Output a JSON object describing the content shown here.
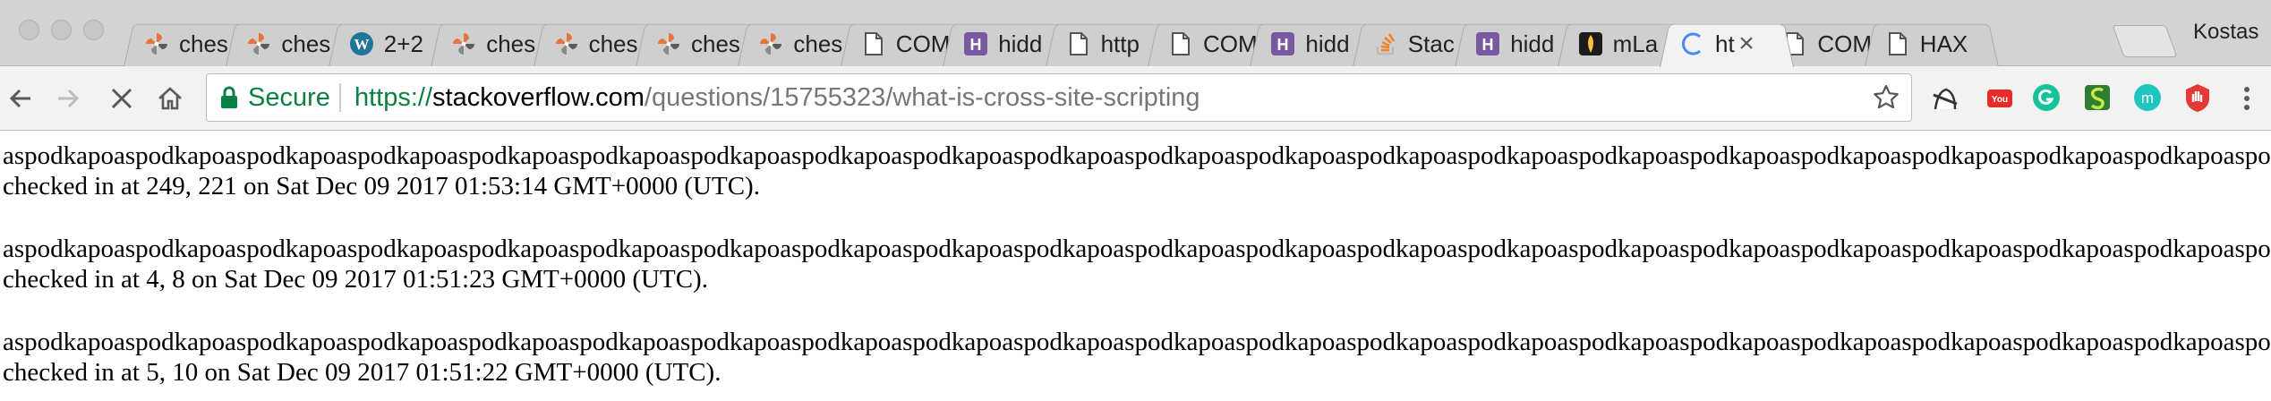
{
  "window": {
    "profile_name": "Kostas"
  },
  "tabs": [
    {
      "title": "ches",
      "icon": "pinwheel-icon",
      "active": false
    },
    {
      "title": "ches",
      "icon": "pinwheel-icon",
      "active": false
    },
    {
      "title": "2+2",
      "icon": "wordpress-icon",
      "active": false
    },
    {
      "title": "ches",
      "icon": "pinwheel-icon",
      "active": false
    },
    {
      "title": "ches",
      "icon": "pinwheel-icon",
      "active": false
    },
    {
      "title": "ches",
      "icon": "pinwheel-icon",
      "active": false
    },
    {
      "title": "ches",
      "icon": "pinwheel-icon",
      "active": false
    },
    {
      "title": "COM",
      "icon": "page-icon",
      "active": false
    },
    {
      "title": "hidd",
      "icon": "heroku-icon",
      "active": false
    },
    {
      "title": "http",
      "icon": "page-icon",
      "active": false
    },
    {
      "title": "COM",
      "icon": "page-icon",
      "active": false
    },
    {
      "title": "hidd",
      "icon": "heroku-icon",
      "active": false
    },
    {
      "title": "Stac",
      "icon": "stackoverflow-icon",
      "active": false
    },
    {
      "title": "hidd",
      "icon": "heroku-icon",
      "active": false
    },
    {
      "title": "mLa",
      "icon": "mlab-icon",
      "active": false
    },
    {
      "title": "ht",
      "icon": "loading-spinner-icon",
      "active": true
    },
    {
      "title": "COM",
      "icon": "page-icon",
      "active": false
    },
    {
      "title": "HAX",
      "icon": "page-icon",
      "active": false
    }
  ],
  "toolbar": {
    "secure_label": "Secure",
    "url_scheme": "https://",
    "url_host": "stackoverflow.com",
    "url_path": "/questions/15755323/what-is-cross-site-scripting"
  },
  "extensions": [
    {
      "icon": "ghost-extension-icon"
    },
    {
      "icon": "youtube-extension-icon"
    },
    {
      "icon": "grammarly-extension-icon"
    },
    {
      "icon": "green-s-extension-icon"
    },
    {
      "icon": "m-extension-icon"
    },
    {
      "icon": "hand-stop-extension-icon"
    }
  ],
  "entries": [
    {
      "spam": "aspodkapoaspodkapoaspodkapoaspodkapoaspodkapoaspodkapoaspodkapoaspodkapoaspodkapoaspodkapoaspodkapoaspodkapoaspodkapoaspodkapoaspodkapoaspodkapoaspodkapoaspodkapoaspodkapoaspodkapoaspodkapoaspodkapoaspodkapo",
      "checked": "checked in at 249, 221 on Sat Dec 09 2017 01:53:14 GMT+0000 (UTC)."
    },
    {
      "spam": "aspodkapoaspodkapoaspodkapoaspodkapoaspodkapoaspodkapoaspodkapoaspodkapoaspodkapoaspodkapoaspodkapoaspodkapoaspodkapoaspodkapoaspodkapoaspodkapoaspodkapoaspodkapoaspodkapoaspodkapoaspodkapoaspodkapoaspodkapo",
      "checked": "checked in at 4, 8 on Sat Dec 09 2017 01:51:23 GMT+0000 (UTC)."
    },
    {
      "spam": "aspodkapoaspodkapoaspodkapoaspodkapoaspodkapoaspodkapoaspodkapoaspodkapoaspodkapoaspodkapoaspodkapoaspodkapoaspodkapoaspodkapoaspodkapoaspodkapoaspodkapoaspodkapoaspodkapoaspodkapoaspodkapoaspodkapoaspodkapo",
      "checked": "checked in at 5, 10 on Sat Dec 09 2017 01:51:22 GMT+0000 (UTC)."
    }
  ]
}
